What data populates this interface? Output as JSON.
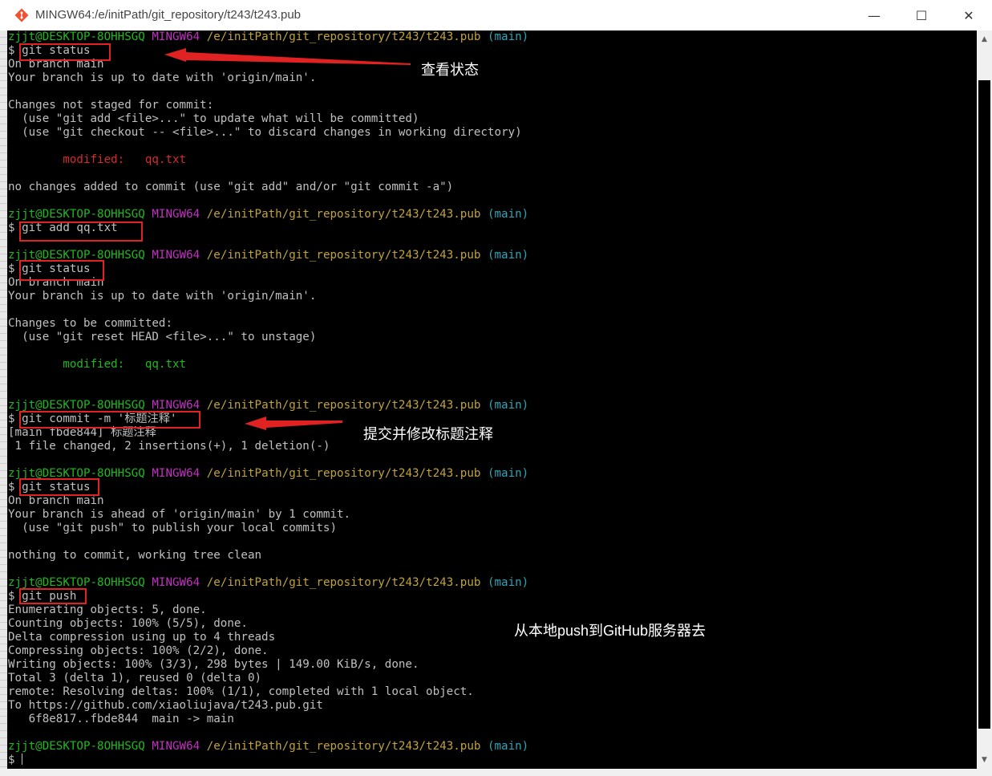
{
  "window": {
    "title": "MINGW64:/e/initPath/git_repository/t243/t243.pub",
    "minimize_glyph": "—",
    "maximize_glyph": "☐",
    "close_glyph": "✕",
    "app_icon": "git-bash-icon"
  },
  "prompt": {
    "user": "zjjt@DESKTOP-8OHHSGQ",
    "shell": "MINGW64",
    "path": "/e/initPath/git_repository/t243/t243.pub",
    "branch": "(main)",
    "symbol": "$"
  },
  "commands": {
    "c1": "git status",
    "c2": "git add qq.txt",
    "c3": "git status",
    "c4": "git commit -m '标题注释'",
    "c5": "git status",
    "c6": "git push"
  },
  "output": {
    "s1_l1": "On branch main",
    "s1_l2": "Your branch is up to date with 'origin/main'.",
    "s1_l3": "Changes not staged for commit:",
    "s1_l4": "  (use \"git add <file>...\" to update what will be committed)",
    "s1_l5": "  (use \"git checkout -- <file>...\" to discard changes in working directory)",
    "s1_mod_label": "        modified:   ",
    "s1_mod_file": "qq.txt",
    "s1_l6": "no changes added to commit (use \"git add\" and/or \"git commit -a\")",
    "s3_l1": "On branch main",
    "s3_l2": "Your branch is up to date with 'origin/main'.",
    "s3_l3": "Changes to be committed:",
    "s3_l4": "  (use \"git reset HEAD <file>...\" to unstage)",
    "s3_mod_label": "        modified:   ",
    "s3_mod_file": "qq.txt",
    "s4_l1": "[main fbde844] 标题注释",
    "s4_l2": " 1 file changed, 2 insertions(+), 1 deletion(-)",
    "s5_l1": "On branch main",
    "s5_l2": "Your branch is ahead of 'origin/main' by 1 commit.",
    "s5_l3": "  (use \"git push\" to publish your local commits)",
    "s5_l4": "nothing to commit, working tree clean",
    "s6_l1": "Enumerating objects: 5, done.",
    "s6_l2": "Counting objects: 100% (5/5), done.",
    "s6_l3": "Delta compression using up to 4 threads",
    "s6_l4": "Compressing objects: 100% (2/2), done.",
    "s6_l5": "Writing objects: 100% (3/3), 298 bytes | 149.00 KiB/s, done.",
    "s6_l6": "Total 3 (delta 1), reused 0 (delta 0)",
    "s6_l7": "remote: Resolving deltas: 100% (1/1), completed with 1 local object.",
    "s6_l8": "To https://github.com/xiaoliujava/t243.pub.git",
    "s6_l9": "   6f8e817..fbde844  main -> main"
  },
  "annotations": {
    "status_note": "查看状态",
    "commit_note": "提交并修改标题注释",
    "push_note": "从本地push到GitHub服务器去"
  },
  "colors": {
    "terminal_bg": "#000000",
    "text": "#c0c0c0",
    "prompt_user": "#1fb81f",
    "prompt_shell": "#c231c2",
    "prompt_path": "#c0a33a",
    "prompt_branch": "#2aa6b8",
    "modified_unstaged": "#d72a2a",
    "modified_staged": "#1fb81f",
    "annotation": "#e02222"
  }
}
